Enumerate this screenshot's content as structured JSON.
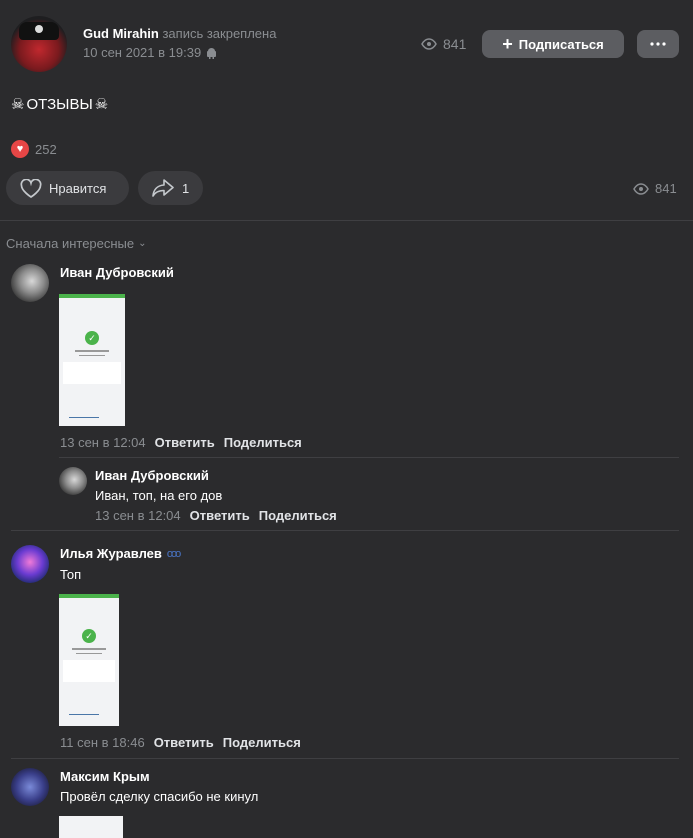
{
  "post": {
    "author": "Gud Mirahin",
    "pinned_note": "запись закреплена",
    "date": "10 сен 2021 в 19:39",
    "views": "841",
    "subscribe_label": "Подписаться",
    "more_icon": "more-icon",
    "text": "ОТЗЫВЫ",
    "reactions_count": "252",
    "like_label": "Нравится",
    "share_count": "1",
    "bottom_views": "841"
  },
  "comments": {
    "sort_label": "Сначала интересные",
    "items": [
      {
        "author": "Иван Дубровский",
        "date": "13 сен в 12:04",
        "reply": "Ответить",
        "share": "Поделиться",
        "reply_item": {
          "author": "Иван Дубровский",
          "text": "Иван, топ, на его дов",
          "date": "13 сен в 12:04",
          "reply": "Ответить",
          "share": "Поделиться"
        }
      },
      {
        "author": "Илья Журавлев",
        "text": "Топ",
        "date": "11 сен в 18:46",
        "reply": "Ответить",
        "share": "Поделиться"
      },
      {
        "author": "Максим Крым",
        "text": "Провёл сделку спасибо не кинул"
      }
    ]
  },
  "colors": {
    "background": "#2b2b2d",
    "accent_green": "#4bb34b",
    "reaction_red": "#e64646",
    "button_gray": "#5c5d61"
  }
}
